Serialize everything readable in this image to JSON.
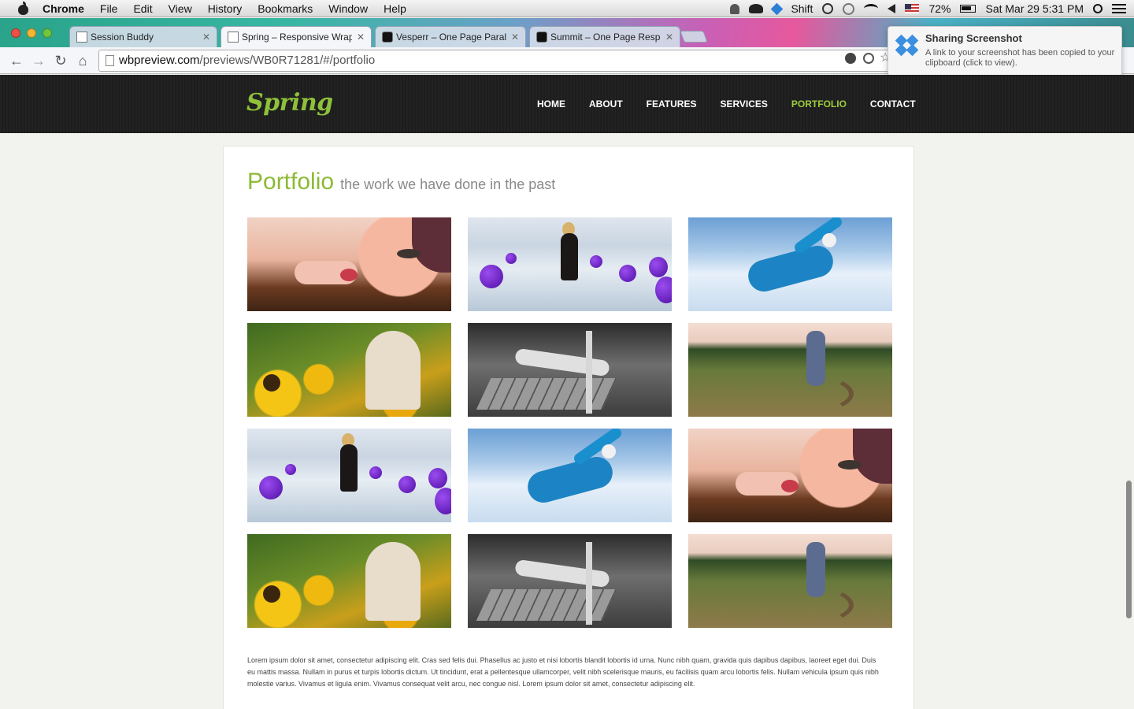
{
  "menubar": {
    "app": "Chrome",
    "items": [
      "File",
      "Edit",
      "View",
      "History",
      "Bookmarks",
      "Window",
      "Help"
    ],
    "keyboard": "Shift",
    "battery": "72%",
    "datetime": "Sat Mar 29  5:31 PM"
  },
  "tabs": [
    {
      "title": "Session Buddy"
    },
    {
      "title": "Spring – Responsive Wrap"
    },
    {
      "title": "Vesperr – One Page Paralla"
    },
    {
      "title": "Summit – One Page Respo"
    }
  ],
  "address": {
    "host": "wbpreview.com",
    "path": "/previews/WB0R71281/#/portfolio"
  },
  "notification": {
    "title": "Sharing Screenshot",
    "body": "A link to your screenshot has been copied to your clipboard (click to view)."
  },
  "site": {
    "logo": "Spring",
    "nav": [
      "HOME",
      "ABOUT",
      "FEATURES",
      "SERVICES",
      "PORTFOLIO",
      "CONTACT"
    ],
    "active_nav": "PORTFOLIO",
    "accent": "#8cba34"
  },
  "portfolio": {
    "title": "Portfolio",
    "subtitle": "the work we have done in the past",
    "lorem": "Lorem ipsum dolor sit amet, consectetur adipiscing elit. Cras sed felis dui. Phasellus ac justo et nisi lobortis blandit lobortis id urna. Nunc nibh quam, gravida quis dapibus dapibus, laoreet eget dui. Duis eu mattis massa. Nullam in purus et turpis lobortis dictum. Ut tincidunt, erat a pellentesque ullamcorper, velit nibh scelerisque mauris, eu facilisis quam arcu lobortis felis. Nullam vehicula ipsum quis nibh molestie varius. Vivamus et ligula enim. Vivamus consequat velit arcu, nec congue nisl. Lorem ipsum dolor sit amet, consectetur adipiscing elit."
  }
}
